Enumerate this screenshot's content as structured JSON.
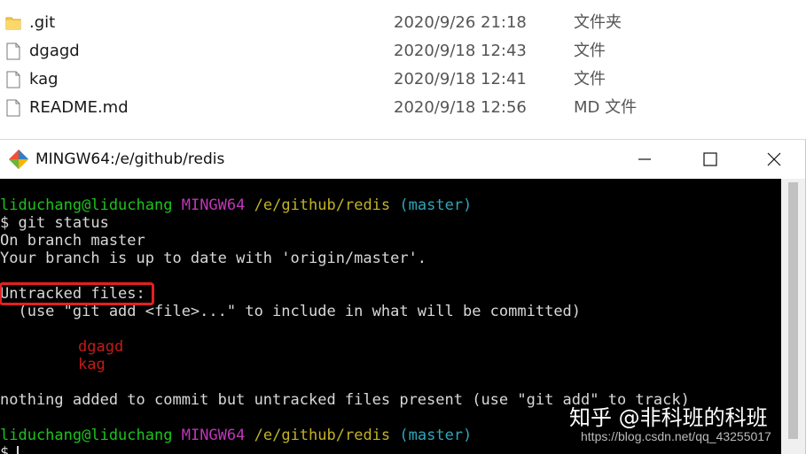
{
  "explorer": {
    "files": [
      {
        "name": ".git",
        "date": "2020/9/26 21:18",
        "type": "文件夹",
        "icon": "folder-icon"
      },
      {
        "name": "dgagd",
        "date": "2020/9/18 12:43",
        "type": "文件",
        "icon": "file-icon"
      },
      {
        "name": "kag",
        "date": "2020/9/18 12:41",
        "type": "文件",
        "icon": "file-icon"
      },
      {
        "name": "README.md",
        "date": "2020/9/18 12:56",
        "type": "MD 文件",
        "icon": "file-icon"
      }
    ]
  },
  "window": {
    "title": "MINGW64:/e/github/redis",
    "icon": "git-icon",
    "buttons": [
      "minimize-icon",
      "maximize-icon",
      "close-icon"
    ]
  },
  "terminal": {
    "prompt_user": "liduchang@liduchang",
    "prompt_system": "MINGW64",
    "prompt_path": "/e/github/redis",
    "prompt_branch": "(master)",
    "command": "$ git status",
    "out_branch": "On branch master",
    "out_uptodate": "Your branch is up to date with 'origin/master'.",
    "out_untracked_header": "Untracked files:",
    "out_hint": "  (use \"git add <file>...\" to include in what will be committed)",
    "untracked_files": [
      "dgagd",
      "kag"
    ],
    "out_nothing": "nothing added to commit but untracked files present (use \"git add\" to track)",
    "final_prompt": "$",
    "colors": {
      "user": "#1cc31c",
      "system": "#c035bb",
      "path": "#c2b225",
      "branch": "#2fa6b8",
      "untracked": "#c31a1a",
      "highlight": "#e61f1f"
    }
  },
  "watermark": {
    "main": "知乎 @非科班的科班",
    "url": "https://blog.csdn.net/qq_43255017"
  }
}
